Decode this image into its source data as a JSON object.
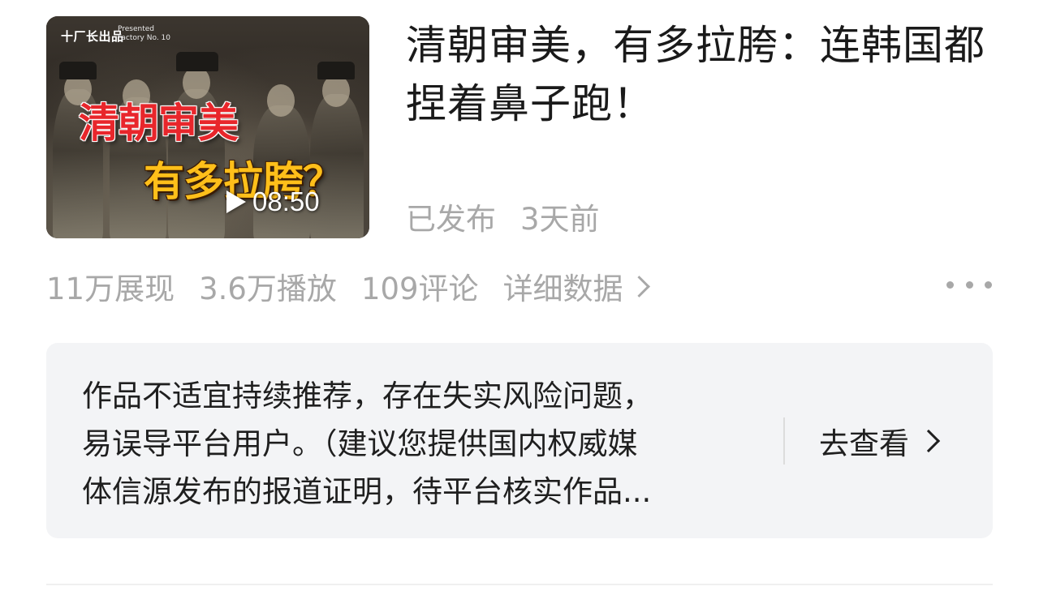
{
  "video": {
    "thumbnail": {
      "brand": "十厂长出品",
      "brand_sub_line1": "Presented",
      "brand_sub_line2": "Factory No. 10",
      "overlay_title_line1": "清朝审美",
      "overlay_title_line2": "有多拉胯？",
      "play_icon": "play-triangle-icon",
      "duration": "08:50"
    },
    "title": "清朝审美，有多拉胯：连韩国都捏着鼻子跑！",
    "status": "已发布",
    "published_ago": "3天前"
  },
  "stats": {
    "impressions": "11万展现",
    "plays": "3.6万播放",
    "comments": "109评论",
    "detail_link": "详细数据",
    "more_icon": "more-dots-icon"
  },
  "notice": {
    "line1": "作品不适宜持续推荐，存在失实风险问题，",
    "line2": "易误导平台用户。（建议您提供国内权威媒",
    "line3": "体信源发布的报道证明，待平台核实作品...",
    "action_label": "去查看"
  },
  "colors": {
    "text_primary": "#1a1a1a",
    "text_secondary": "#a8a8a8",
    "card_bg": "#f3f4f6",
    "overlay_red": "#e8262b",
    "overlay_yellow": "#ffbf1a"
  }
}
